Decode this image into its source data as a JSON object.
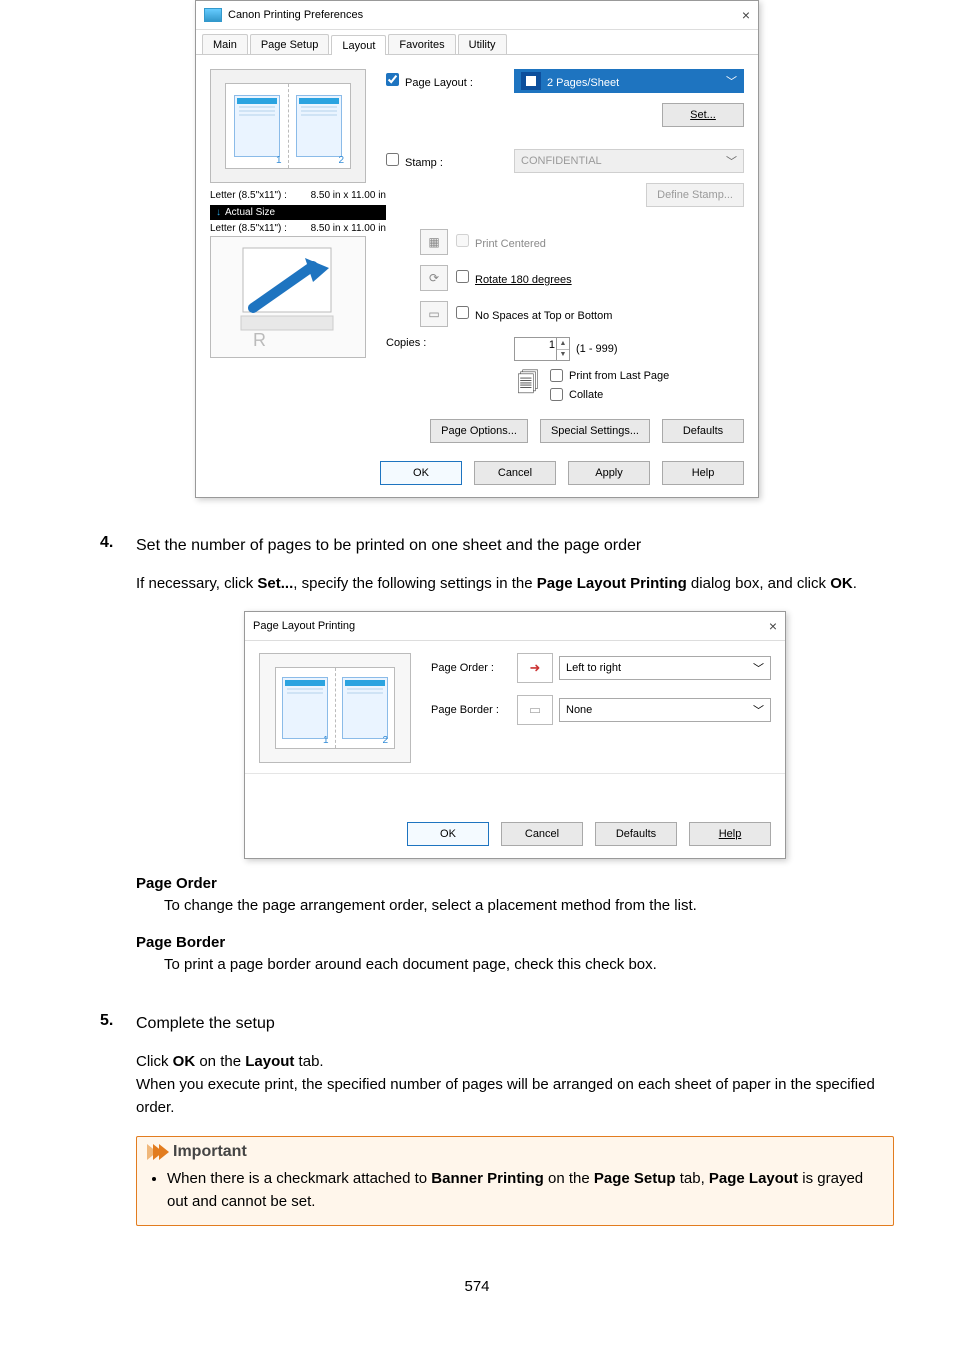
{
  "dialog1": {
    "title": "Canon          Printing Preferences",
    "tabs": [
      "Main",
      "Page Setup",
      "Layout",
      "Favorites",
      "Utility"
    ],
    "active_tab": 2,
    "page_layout_label": "Page Layout :",
    "page_layout_value": "2 Pages/Sheet",
    "set_btn": "Set...",
    "stamp_label": "Stamp :",
    "stamp_value": "CONFIDENTIAL",
    "define_stamp_btn": "Define Stamp...",
    "paper1_a": "Letter (8.5\"x11\") :",
    "paper1_b": "8.50 in x 11.00 in",
    "actual_size": "Actual Size",
    "paper2_a": "Letter (8.5\"x11\") :",
    "paper2_b": "8.50 in x 11.00 in",
    "print_centered": "Print Centered",
    "rotate180": "Rotate 180 degrees",
    "no_spaces": "No Spaces at Top or Bottom",
    "copies_label": "Copies :",
    "copies_value": "1",
    "copies_range": "(1 - 999)",
    "print_from_last": "Print from Last Page",
    "collate": "Collate",
    "page_options_btn": "Page Options...",
    "special_settings_btn": "Special Settings...",
    "defaults_btn": "Defaults",
    "ok": "OK",
    "cancel": "Cancel",
    "apply": "Apply",
    "help": "Help"
  },
  "step4": {
    "num": "4.",
    "title": "Set the number of pages to be printed on one sheet and the page order",
    "para_a": "If necessary, click ",
    "set": "Set...",
    "para_b": ", specify the following settings in the ",
    "dlg_name": "Page Layout Printing",
    "para_c": " dialog box, and click ",
    "ok_b": "OK",
    "para_d": "."
  },
  "dialog2": {
    "title": "Page Layout Printing",
    "page_order_label": "Page Order :",
    "page_order_value": "Left to right",
    "page_border_label": "Page Border :",
    "page_border_value": "None",
    "ok": "OK",
    "cancel": "Cancel",
    "defaults": "Defaults",
    "help": "Help"
  },
  "defs": {
    "page_order_h": "Page Order",
    "page_order_t": "To change the page arrangement order, select a placement method from the list.",
    "page_border_h": "Page Border",
    "page_border_t": "To print a page border around each document page, check this check box."
  },
  "step5": {
    "num": "5.",
    "title": "Complete the setup",
    "p1a": "Click ",
    "p1b": "OK",
    "p1c": " on the ",
    "p1d": "Layout",
    "p1e": " tab.",
    "p2": "When you execute print, the specified number of pages will be arranged on each sheet of paper in the specified order."
  },
  "important": {
    "heading": "Important",
    "i_a": "When there is a checkmark attached to ",
    "i_b": "Banner Printing",
    "i_c": " on the ",
    "i_d": "Page Setup",
    "i_e": " tab, ",
    "i_f": "Page Layout",
    "i_g": " is grayed out and cannot be set."
  },
  "page_number": "574"
}
